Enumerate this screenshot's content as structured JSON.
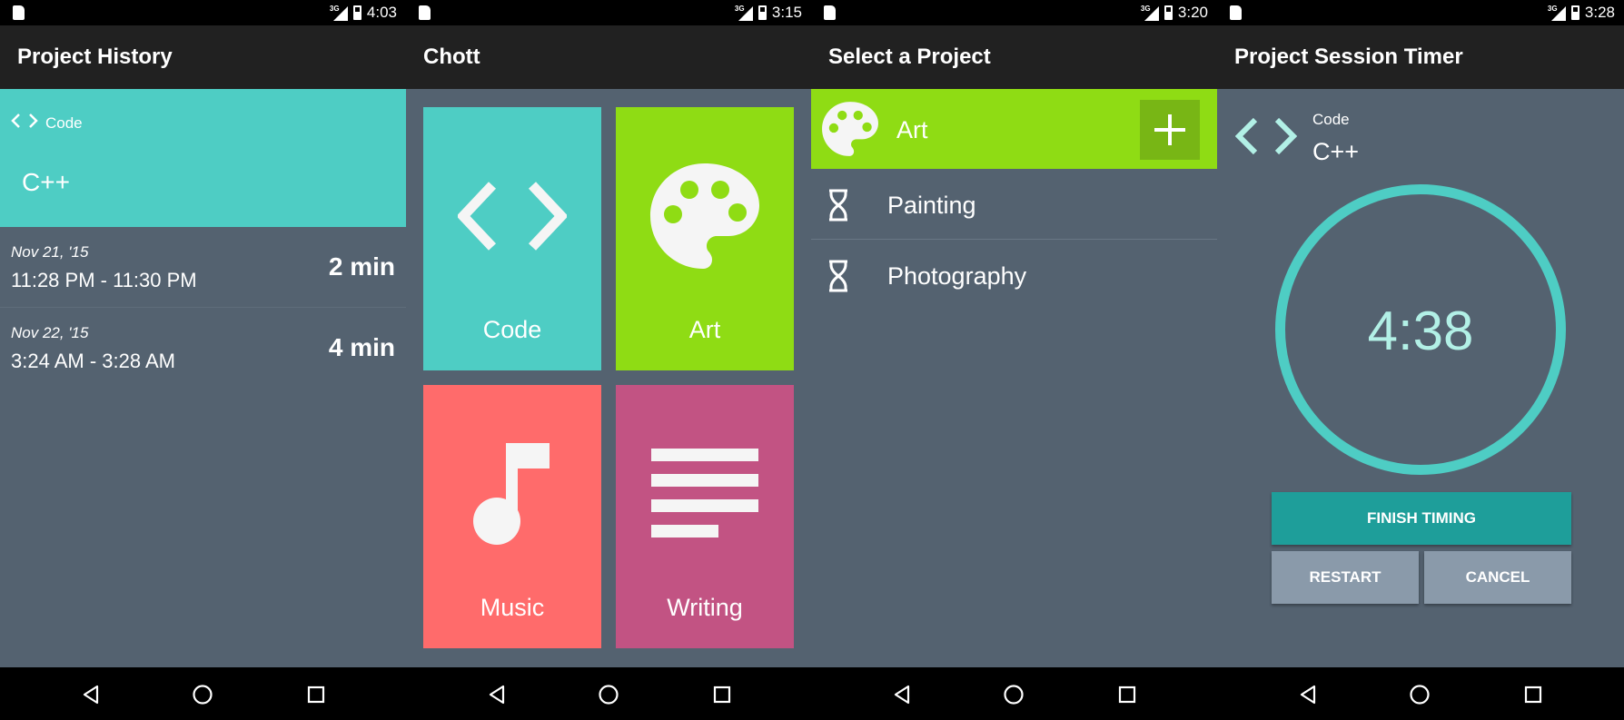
{
  "colors": {
    "teal": "#4ecdc4",
    "green": "#8fdc14",
    "coral": "#ff6b6b",
    "magenta": "#c25383",
    "background": "#546270",
    "appbar": "#212121",
    "button_finish": "#1e9e9a",
    "button_secondary": "#8a9aaa"
  },
  "status_icons": [
    "sd-card-icon",
    "signal-3g-icon",
    "battery-icon"
  ],
  "nav_icons": [
    "back-icon",
    "home-icon",
    "recents-icon"
  ],
  "screens": [
    {
      "status_time": "4:03",
      "title": "Project History",
      "header": {
        "category": "Code",
        "category_icon": "code-icon",
        "project": "C++"
      },
      "sessions": [
        {
          "date": "Nov 21, '15",
          "range": "11:28 PM - 11:30 PM",
          "duration": "2 min"
        },
        {
          "date": "Nov 22, '15",
          "range": "3:24 AM - 3:28 AM",
          "duration": "4 min"
        }
      ]
    },
    {
      "status_time": "3:15",
      "title": "Chott",
      "tiles": [
        {
          "label": "Code",
          "icon": "code-icon",
          "color": "#4ecdc4"
        },
        {
          "label": "Art",
          "icon": "palette-icon",
          "color": "#8fdc14"
        },
        {
          "label": "Music",
          "icon": "music-note-icon",
          "color": "#ff6b6b"
        },
        {
          "label": "Writing",
          "icon": "text-lines-icon",
          "color": "#c25383"
        }
      ]
    },
    {
      "status_time": "3:20",
      "title": "Select a Project",
      "category": {
        "label": "Art",
        "icon": "palette-icon",
        "add_icon": "add-icon"
      },
      "projects": [
        {
          "label": "Painting",
          "icon": "hourglass-icon"
        },
        {
          "label": "Photography",
          "icon": "hourglass-icon"
        }
      ]
    },
    {
      "status_time": "3:28",
      "title": "Project Session Timer",
      "category": "Code",
      "category_icon": "code-icon",
      "project": "C++",
      "timer": "4:38",
      "buttons": {
        "finish": "FINISH TIMING",
        "restart": "RESTART",
        "cancel": "CANCEL"
      }
    }
  ]
}
